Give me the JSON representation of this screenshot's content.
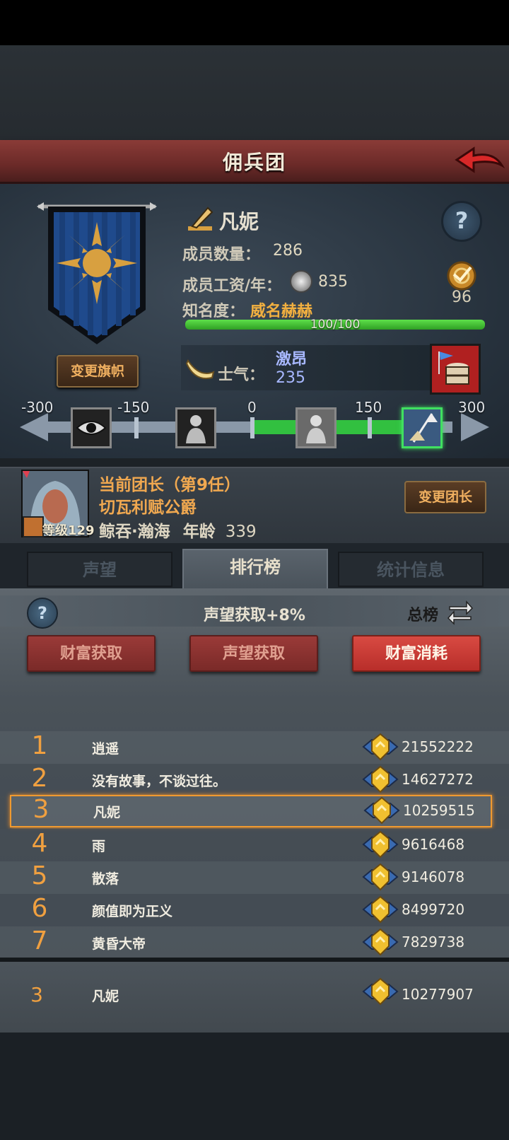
{
  "header": {
    "title": "佣兵团"
  },
  "guild": {
    "name": "凡妮",
    "change_flag_label": "变更旗帜",
    "members_label": "成员数量：",
    "members_value": "286",
    "salary_label": "成员工资/年：",
    "salary_value": "835",
    "fame_label": "知名度：",
    "fame_rank": "威名赫赫",
    "fame_progress_text": "100/100",
    "fame_progress": 1.0,
    "target_value": "96",
    "morale_label": "士气：",
    "morale_state": "激昂",
    "morale_value": "235"
  },
  "morale_scale": {
    "ticks": [
      "-300",
      "-150",
      "0",
      "150",
      "300"
    ],
    "current": 235,
    "states": [
      "eye-icon",
      "despair-icon",
      "calm-icon",
      "rally-flag-icon"
    ],
    "active_state_index": 3
  },
  "leader": {
    "line1": "当前团长（第9任）",
    "line2": "切瓦利赋公爵",
    "race_trait": "鲸吞·瀚海",
    "age_label": "年龄",
    "age_value": "339",
    "level_text": "等级129",
    "change_leader_label": "变更团长"
  },
  "tabs": [
    {
      "label": "声望",
      "active": false
    },
    {
      "label": "排行榜",
      "active": true
    },
    {
      "label": "统计信息",
      "active": false
    }
  ],
  "ranking": {
    "bonus_text": "声望获取+8%",
    "total_label": "总榜",
    "categories": [
      {
        "label": "财富获取",
        "active": false
      },
      {
        "label": "声望获取",
        "active": false
      },
      {
        "label": "财富消耗",
        "active": true
      }
    ],
    "rows": [
      {
        "rank": "1",
        "name": "逍遥",
        "score": "21552222"
      },
      {
        "rank": "2",
        "name": "没有故事，不谈过往。",
        "score": "14627272"
      },
      {
        "rank": "3",
        "name": "凡妮",
        "score": "10259515",
        "me": true
      },
      {
        "rank": "4",
        "name": "雨",
        "score": "9616468"
      },
      {
        "rank": "5",
        "name": "散落",
        "score": "9146078"
      },
      {
        "rank": "6",
        "name": "颜值即为正义",
        "score": "8499720"
      },
      {
        "rank": "7",
        "name": "黄昏大帝",
        "score": "7829738"
      }
    ],
    "my_row": {
      "rank": "3",
      "name": "凡妮",
      "score": "10277907"
    }
  },
  "colors": {
    "header": "#7a302d",
    "accent_orange": "#f0a040",
    "morale_blue": "#a8b8ff",
    "progress_green": "#3fc030"
  }
}
